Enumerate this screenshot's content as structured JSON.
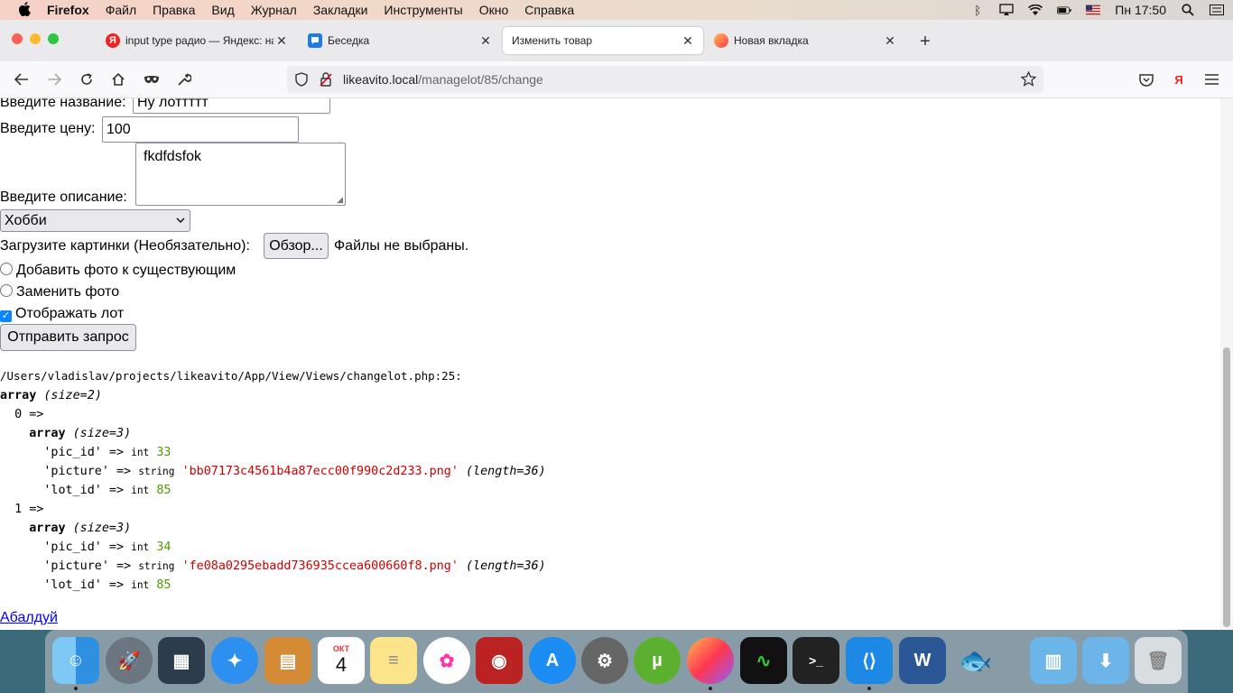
{
  "menubar": {
    "app": "Firefox",
    "items": [
      "Файл",
      "Правка",
      "Вид",
      "Журнал",
      "Закладки",
      "Инструменты",
      "Окно",
      "Справка"
    ],
    "clock": "Пн 17:50"
  },
  "tabs": [
    {
      "title": "input type радио — Яндекс: на",
      "icon": "yandex-icon",
      "active": false
    },
    {
      "title": "Беседка",
      "icon": "chat-icon",
      "active": false
    },
    {
      "title": "Изменить товар",
      "icon": "",
      "active": true
    },
    {
      "title": "Новая вкладка",
      "icon": "firefox-icon",
      "active": false
    }
  ],
  "url": {
    "host": "likeavito.local",
    "path": "/managelot/85/change"
  },
  "form": {
    "name_label": "Введите название:",
    "name_value": "Ну лоттттт",
    "price_label": "Введите цену:",
    "price_value": "100",
    "desc_label": "Введите описание:",
    "desc_value": "fkdfdsfok",
    "category_value": "Хобби",
    "upload_label": "Загрузите картинки (Необязательно):",
    "browse_label": "Обзор...",
    "no_files": "Файлы не выбраны.",
    "radio_add": "Добавить фото к существующим",
    "radio_replace": "Заменить фото",
    "checkbox_show": "Отображать лот",
    "checkbox_checked": true,
    "submit_label": "Отправить запрос"
  },
  "dump": {
    "path": "/Users/vladislav/projects/likeavito/App/View/Views/changelot.php:25:",
    "size_outer": "2",
    "items": [
      {
        "index": "0",
        "size": "3",
        "pic_id": "33",
        "picture": "'bb07173c4561b4a87ecc00f990c2d233.png'",
        "length": "36",
        "lot_id": "85"
      },
      {
        "index": "1",
        "size": "3",
        "pic_id": "34",
        "picture": "'fe08a0295ebadd736935ccea600660f8.png'",
        "length": "36",
        "lot_id": "85"
      }
    ]
  },
  "link_text": "Абалдуй",
  "dock": [
    "finder-icon",
    "launchpad-icon",
    "mission-control-icon",
    "safari-icon",
    "calculator-icon",
    "calendar-icon",
    "notes-icon",
    "photos-icon",
    "photo-booth-icon",
    "app-store-icon",
    "system-preferences-icon",
    "utorrent-icon",
    "firefox-icon",
    "activity-monitor-icon",
    "terminal-icon",
    "vscode-icon",
    "word-icon",
    "fish-icon",
    "applications-folder-icon",
    "downloads-folder-icon",
    "trash-icon"
  ],
  "calendar": {
    "month": "ОКТ",
    "day": "4"
  },
  "colors": {
    "accent": "#0a84ff",
    "link": "#0000ee",
    "string": "#cc0000",
    "number": "#4e9a06"
  }
}
